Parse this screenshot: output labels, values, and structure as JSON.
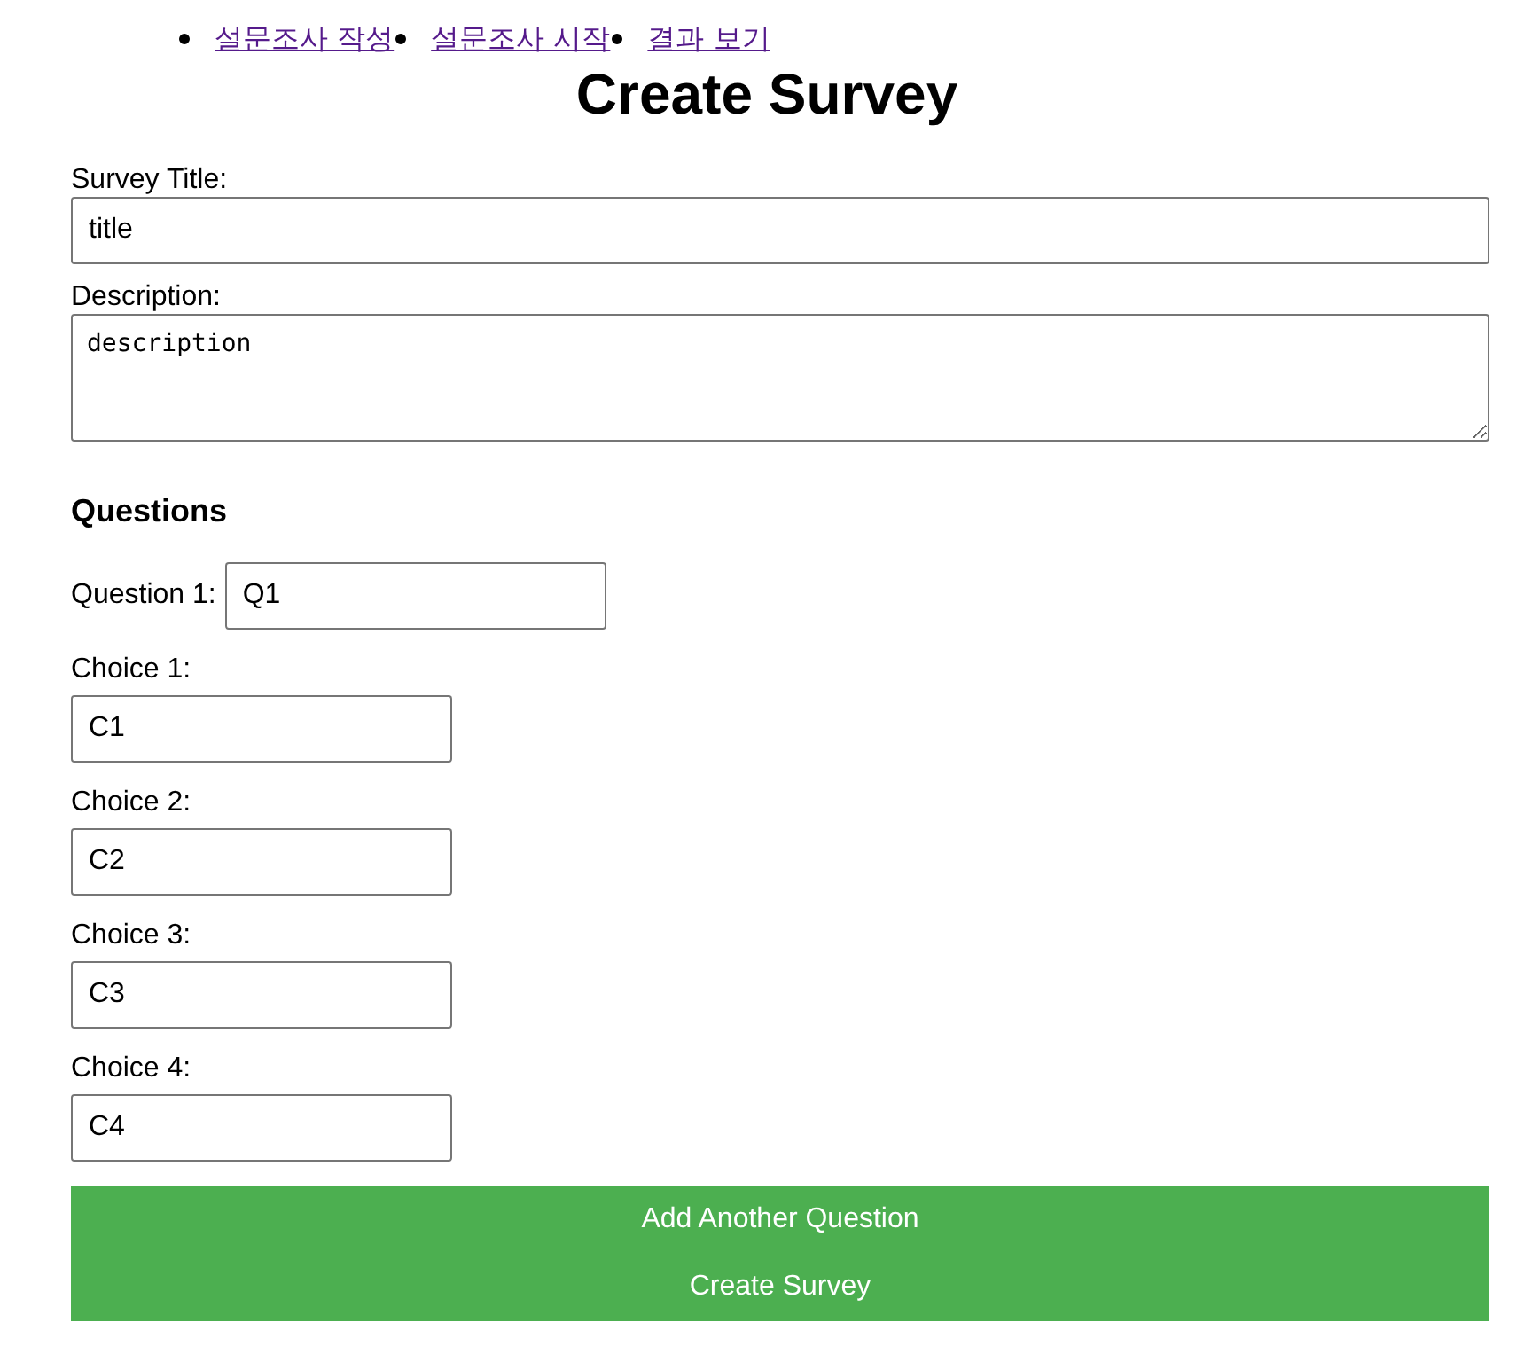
{
  "nav": [
    {
      "label": "설문조사 작성"
    },
    {
      "label": "설문조사 시작"
    },
    {
      "label": "결과 보기"
    }
  ],
  "title": "Create Survey",
  "survey_title": {
    "label": "Survey Title:",
    "value": "title"
  },
  "description": {
    "label": "Description:",
    "value": "description"
  },
  "questions_heading": "Questions",
  "questions": [
    {
      "label": "Question 1:",
      "value": "Q1",
      "choices": [
        {
          "label": "Choice 1:",
          "value": "C1"
        },
        {
          "label": "Choice 2:",
          "value": "C2"
        },
        {
          "label": "Choice 3:",
          "value": "C3"
        },
        {
          "label": "Choice 4:",
          "value": "C4"
        }
      ]
    }
  ],
  "buttons": [
    {
      "label": "Add Another Question"
    },
    {
      "label": "Create Survey"
    }
  ]
}
